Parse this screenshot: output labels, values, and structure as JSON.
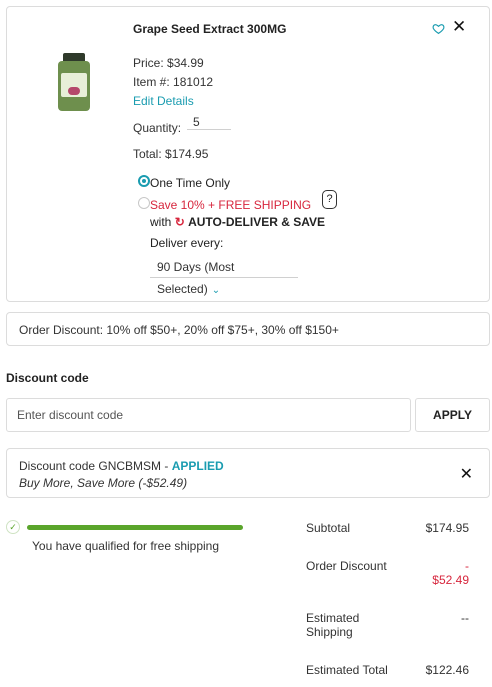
{
  "product": {
    "name": "Grape Seed Extract 300MG",
    "price_label": "Price:",
    "price": "$34.99",
    "item_label": "Item #:",
    "item_number": "181012",
    "edit_details": "Edit Details",
    "quantity_label": "Quantity:",
    "quantity": "5",
    "total_label": "Total:",
    "total": "$174.95"
  },
  "purchase_options": {
    "one_time": "One Time Only",
    "save_text": "Save 10% + FREE SHIPPING",
    "with_text": "with",
    "auto_deliver": "AUTO-DELIVER & SAVE",
    "help": "?",
    "deliver_every_label": "Deliver every:",
    "deliver_every_value": "90 Days (Most Selected)"
  },
  "icons": {
    "favorite": "heart-icon",
    "close": "close-icon",
    "chevron": "chevron-down-icon",
    "check": "check-icon",
    "auto_deliver": "auto-deliver-icon"
  },
  "order_discount_text": "Order Discount: 10% off $50+, 20% off $75+, 30% off $150+",
  "discount_code": {
    "label": "Discount code",
    "placeholder": "Enter discount code",
    "apply_label": "APPLY",
    "applied_prefix": "Discount code GNCBMSM - ",
    "applied_status": "APPLIED",
    "applied_detail": "Buy More, Save More (-$52.49)"
  },
  "shipping": {
    "progress": 1.0,
    "message": "You have qualified for free shipping"
  },
  "summary": {
    "subtotal_label": "Subtotal",
    "subtotal": "$174.95",
    "order_discount_label": "Order Discount",
    "order_discount_sign": "-",
    "order_discount": "$52.49",
    "est_shipping_label_1": "Estimated",
    "est_shipping_label_2": "Shipping",
    "est_shipping": "--",
    "est_total_label": "Estimated Total",
    "est_total": "$122.46"
  },
  "colors": {
    "accent": "#1a9cb0",
    "alert": "#d7263d",
    "success": "#5aa52b"
  }
}
